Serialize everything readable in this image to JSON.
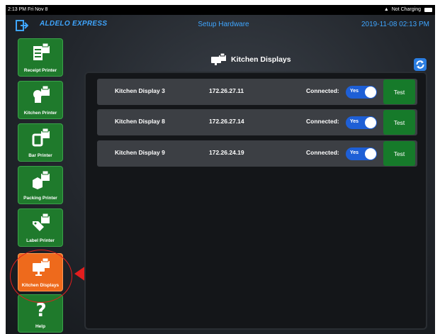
{
  "status_bar": {
    "time_date": "2:13 PM  Fri Nov 8",
    "charging": "Not Charging"
  },
  "header": {
    "brand": "ALDELO EXPRESS",
    "screen_title": "Setup Hardware",
    "datetime": "2019-11-08 02:13 PM"
  },
  "sidebar": {
    "items": [
      {
        "label": "Receipt Printer",
        "icon": "receipt-printer-icon",
        "active": false
      },
      {
        "label": "Kitchen Printer",
        "icon": "kitchen-printer-icon",
        "active": false
      },
      {
        "label": "Bar Printer",
        "icon": "bar-printer-icon",
        "active": false
      },
      {
        "label": "Packing Printer",
        "icon": "packing-printer-icon",
        "active": false
      },
      {
        "label": "Label Printer",
        "icon": "label-printer-icon",
        "active": false
      },
      {
        "label": "Kitchen Displays",
        "icon": "kitchen-display-icon",
        "active": true
      },
      {
        "label": "Help",
        "icon": "help-icon",
        "active": false
      }
    ]
  },
  "content": {
    "title": "Kitchen Displays",
    "connected_label": "Connected:",
    "toggle_label": "Yes",
    "test_label": "Test",
    "displays": [
      {
        "name": "Kitchen Display 3",
        "ip": "172.26.27.11",
        "connected": true
      },
      {
        "name": "Kitchen Display 8",
        "ip": "172.26.27.14",
        "connected": true
      },
      {
        "name": "Kitchen Display 9",
        "ip": "172.26.24.19",
        "connected": true
      }
    ]
  },
  "colors": {
    "brand_blue": "#3fa6ff",
    "button_green": "#1f7a2c",
    "active_orange": "#ee6a1c",
    "toggle_blue": "#1e5fd6",
    "annotation_red": "#e21e1e"
  }
}
